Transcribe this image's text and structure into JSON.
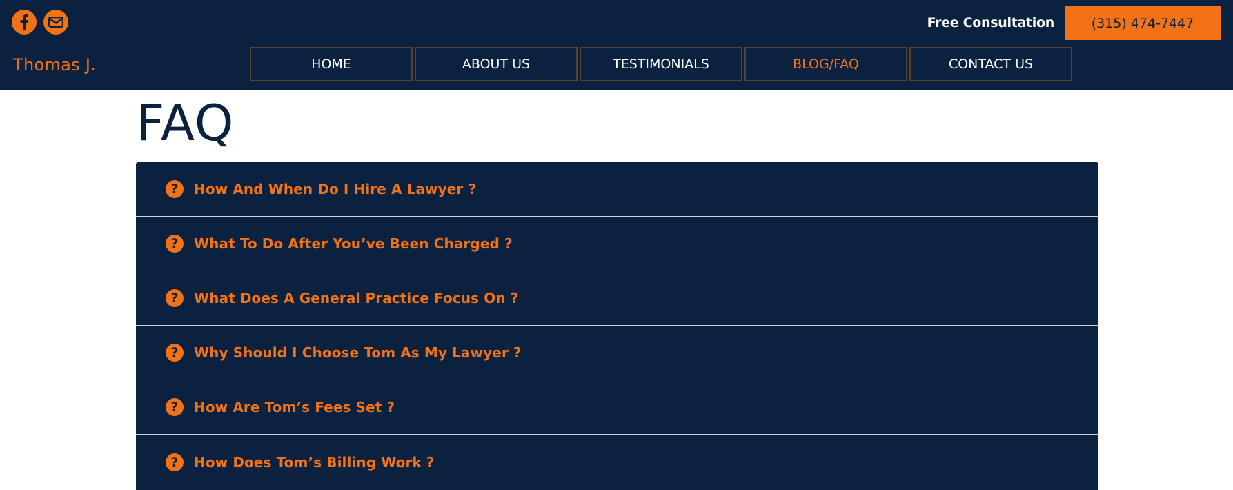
{
  "header": {
    "brand": "Thomas J.",
    "consultation_label": "Free Consultation",
    "phone": "(315) 474-7447",
    "social": [
      {
        "icon": "facebook-icon"
      },
      {
        "icon": "email-icon"
      }
    ]
  },
  "nav": {
    "items": [
      {
        "label": "HOME"
      },
      {
        "label": "ABOUT US"
      },
      {
        "label": "TESTIMONIALS"
      },
      {
        "label": "BLOG/FAQ",
        "active": true
      },
      {
        "label": "CONTACT US"
      }
    ]
  },
  "main": {
    "title": "FAQ",
    "questions": [
      {
        "text": "How And When Do I Hire A Lawyer ?"
      },
      {
        "text": "What To Do After You’ve Been Charged ?"
      },
      {
        "text": "What Does A General Practice Focus On ?"
      },
      {
        "text": "Why Should I Choose Tom As My Lawyer ?"
      },
      {
        "text": "How Are Tom’s Fees Set ?"
      },
      {
        "text": "How Does Tom’s Billing Work ?"
      }
    ]
  },
  "colors": {
    "navy": "#0a2240",
    "orange": "#f47216",
    "nav_border": "#59422f",
    "divider": "#c9d0d8"
  }
}
